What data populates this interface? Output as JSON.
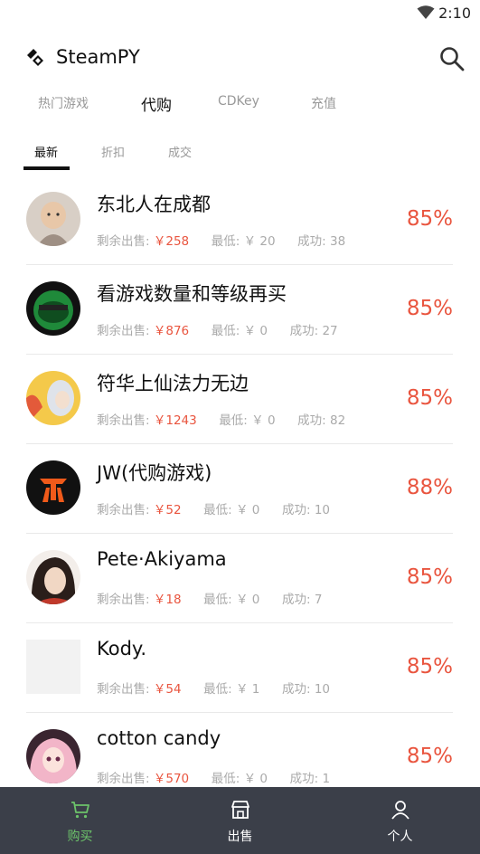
{
  "status_bar": {
    "time": "2:10",
    "wifi_icon": "wifi-icon"
  },
  "app_bar": {
    "title": "SteamPY",
    "logo_icon": "steampy-logo-icon",
    "search_icon": "search-icon"
  },
  "top_tabs": [
    {
      "label": "热门游戏",
      "active": false
    },
    {
      "label": "代购",
      "active": true
    },
    {
      "label": "CDKey",
      "active": false
    },
    {
      "label": "充值",
      "active": false
    }
  ],
  "sub_tabs": [
    {
      "label": "最新",
      "active": true
    },
    {
      "label": "折扣",
      "active": false
    },
    {
      "label": "成交",
      "active": false
    }
  ],
  "meta_labels": {
    "remaining": "剩余出售:",
    "min": "最低:",
    "success": "成功:"
  },
  "list": [
    {
      "name": "东北人在成都",
      "remaining": "￥258",
      "min": "￥ 20",
      "success": "38",
      "rate": "85%"
    },
    {
      "name": "看游戏数量和等级再买",
      "remaining": "￥876",
      "min": "￥ 0",
      "success": "27",
      "rate": "85%"
    },
    {
      "name": "符华上仙法力无边",
      "remaining": "￥1243",
      "min": "￥ 0",
      "success": "82",
      "rate": "85%"
    },
    {
      "name": "JW(代购游戏)",
      "remaining": "￥52",
      "min": "￥ 0",
      "success": "10",
      "rate": "88%"
    },
    {
      "name": "Pete·Akiyama",
      "remaining": "￥18",
      "min": "￥ 0",
      "success": "7",
      "rate": "85%"
    },
    {
      "name": "Kody.",
      "remaining": "￥54",
      "min": "￥ 1",
      "success": "10",
      "rate": "85%"
    },
    {
      "name": "cotton candy",
      "remaining": "￥570",
      "min": "￥ 0",
      "success": "1",
      "rate": "85%"
    }
  ],
  "bottom_nav": [
    {
      "label": "购买",
      "icon": "cart-icon",
      "active": true
    },
    {
      "label": "出售",
      "icon": "store-icon",
      "active": false
    },
    {
      "label": "个人",
      "icon": "person-icon",
      "active": false
    }
  ],
  "colors": {
    "accent": "#e9553f",
    "nav_bg": "#3b3f49",
    "nav_active": "#6cc36a"
  }
}
